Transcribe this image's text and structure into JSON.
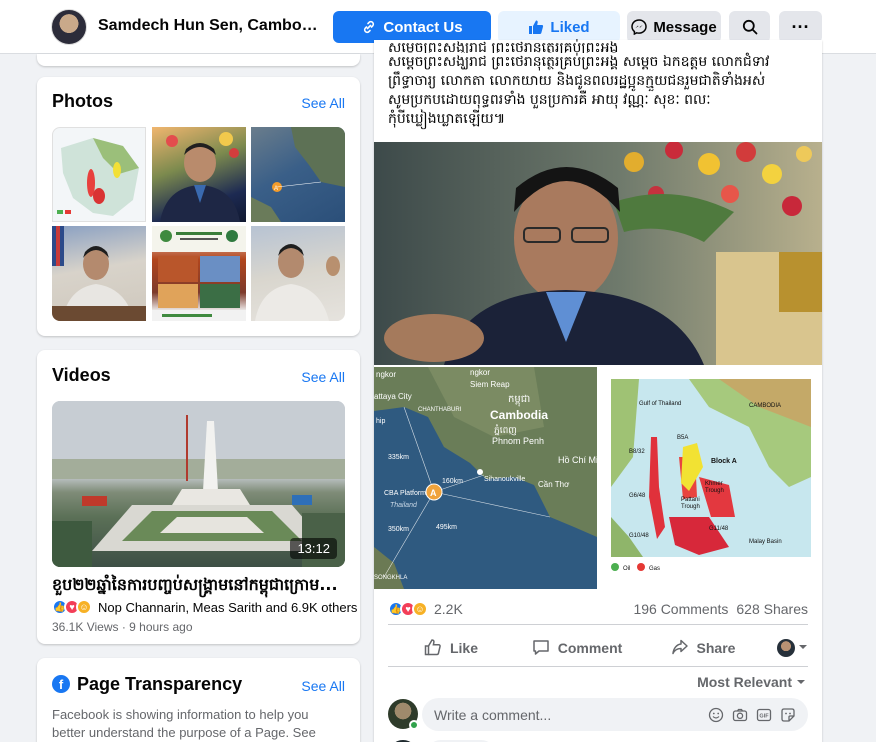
{
  "header": {
    "page_name": "Samdech Hun Sen, Cambodian...",
    "contact_label": "Contact Us",
    "liked_label": "Liked",
    "message_label": "Message",
    "search_icon": "search-icon",
    "more_label": "···"
  },
  "photos": {
    "title": "Photos",
    "see_all": "See All"
  },
  "videos": {
    "title": "Videos",
    "see_all": "See All",
    "duration": "13:12",
    "video_title": "ខួប២២ឆ្នាំនៃការបញ្ចប់សង្គ្រាមនៅកម្ពុជាក្រោម...",
    "reactions_text": "Nop Channarin, Meas Sarith and 6.9K others",
    "meta": "36.1K Views · 9 hours ago"
  },
  "transparency": {
    "title": "Page Transparency",
    "see_all": "See All",
    "text": "Facebook is showing information to help you better understand the purpose of a Page. See"
  },
  "post": {
    "text_line0": "សម្ដេចព្រះសង្ឃរាជ ព្រះថេរានុត្ថេរគ្រប់ព្រះអង្គ",
    "text_line1": "សម្ដេចព្រះសង្ឃរាជ ព្រះថេរានុត្ថេរគ្រប់ព្រះអង្គ  សម្ដេច ឯកឧត្តម លោកជំទាវ",
    "text_line2": "ព្រឹទ្ធាចារ្យ លោកតា លោកយាយ និងជូនពលរដ្ឋប្អូនក្មួយជនរួមជាតិទាំងអស់",
    "text_line3": "សូមប្រកបដោយពុទ្ធពរទាំង បួនប្រការគឺ អាយុ វណ្ណៈ សុខៈ ពលៈ",
    "text_line4": "កុំបីឃ្លៀងឃ្លាតឡើយ៕",
    "map1_labels": {
      "angkor": "ngkor",
      "siem_reap": "Siem Reap",
      "chanthaburi": "CHANTHABURI",
      "pattaya": "attaya City",
      "cambodia": "Cambodia",
      "cambodia_kh": "កម្ពុជា",
      "phnom_penh_kh": "ភ្នំពេញ",
      "phnom_penh": "Phnom Penh",
      "ho_chi_minh": "Hồ Chí Mi",
      "sihanoukville": "Sihanoukville",
      "can_tho": "Cần Thơ",
      "km335": "335km",
      "km160": "160km",
      "km495": "495km",
      "km350": "350km",
      "cba": "CBA Platform",
      "thailand": "Thailand",
      "marker": "A",
      "songkhla": "SONGKHLA",
      "hip": "hip"
    },
    "map2_labels": {
      "gulf": "Gulf of Thailand",
      "cambodia": "CAMBODIA",
      "block_a": "Block A",
      "khmer": "Khmer",
      "trough": "Trough",
      "pattani": "Pattani",
      "pattani_trough": "Trough",
      "malay": "Malay Basin",
      "b8832": "B8/32",
      "b5a": "B5A",
      "g648": "G6/48",
      "g1048": "G10/48",
      "g1148": "G11/48",
      "oil": "Oil",
      "gas": "Gas"
    },
    "reaction_count": "2.2K",
    "comments": "196 Comments",
    "shares": "628 Shares",
    "like_label": "Like",
    "comment_label": "Comment",
    "share_label": "Share",
    "most_relevant": "Most Relevant",
    "comment_placeholder": "Write a comment..."
  },
  "colors": {
    "brand_blue": "#1877f2",
    "liked_bg": "#e7f3ff",
    "page_bg": "#f0f2f5"
  }
}
